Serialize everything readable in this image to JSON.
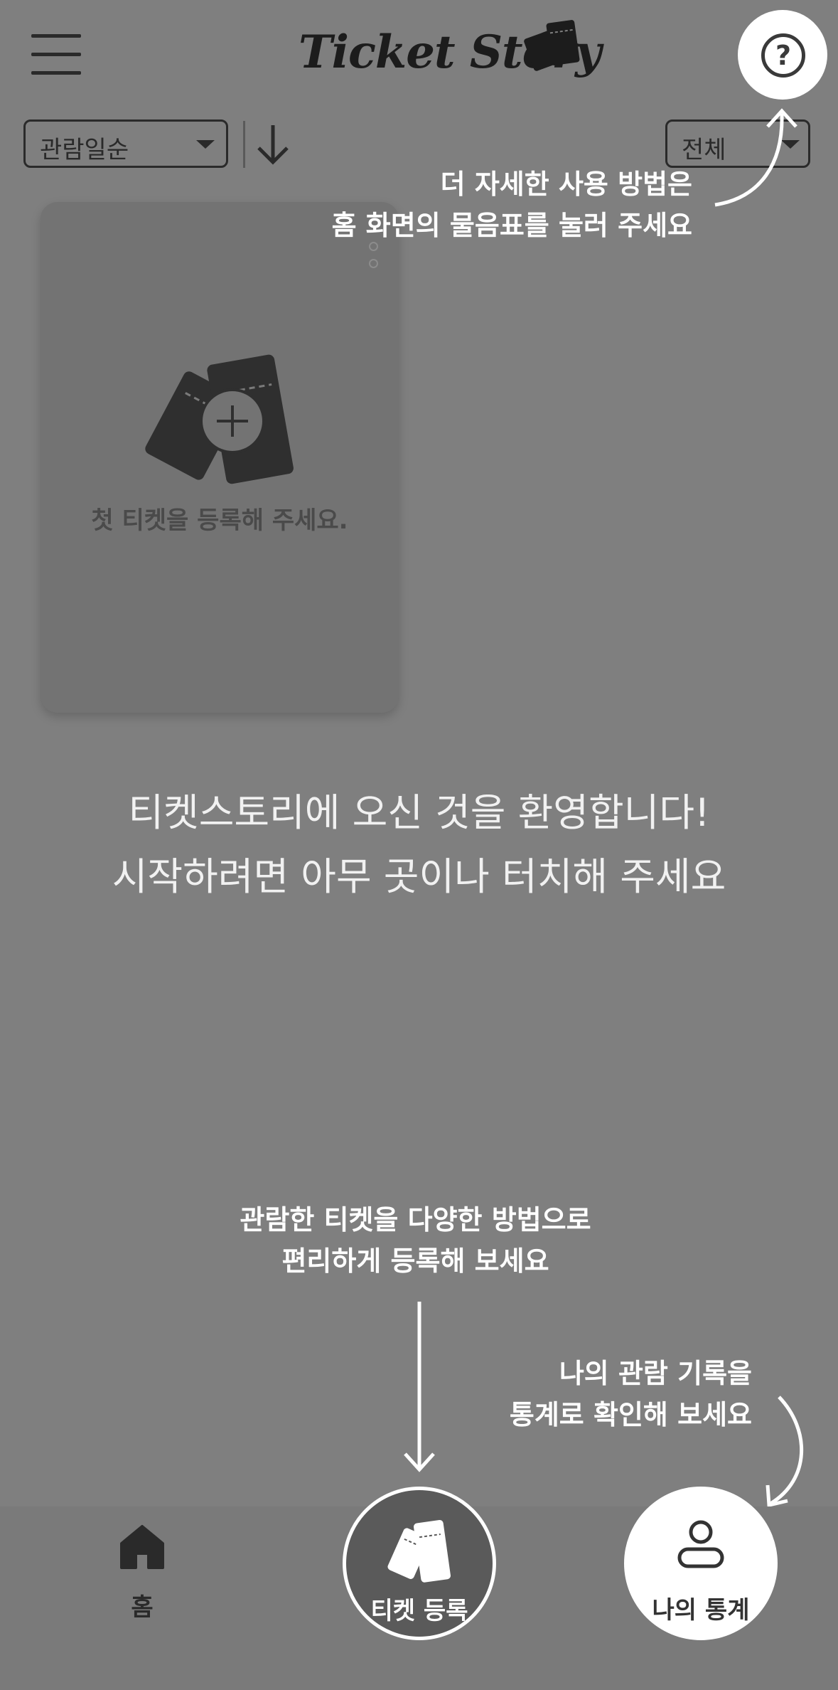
{
  "header": {
    "app_title": "Ticket Story",
    "menu_icon": "hamburger-menu-icon",
    "help_icon": "question-mark-icon"
  },
  "filters": {
    "sort_value": "관람일순",
    "sort_direction_icon": "arrow-down-icon",
    "category_value": "전체"
  },
  "card": {
    "empty_message": "첫 티켓을 등록해 주세요.",
    "add_icon": "ticket-plus-icon"
  },
  "welcome": {
    "line1": "티켓스토리에 오신 것을 환영합니다!",
    "line2": "시작하려면 아무 곳이나 터치해 주세요"
  },
  "tips": {
    "help_line1": "더 자세한 사용 방법은",
    "help_line2": "홈 화면의 물음표를 눌러 주세요",
    "register_line1": "관람한 티켓을 다양한 방법으로",
    "register_line2": "편리하게 등록해 보세요",
    "stats_line1": "나의 관람 기록을",
    "stats_line2": "통계로 확인해 보세요"
  },
  "nav": {
    "home_label": "홈",
    "home_icon": "home-icon",
    "register_label": "티켓 등록",
    "register_icon": "ticket-icon",
    "stats_label": "나의 통계",
    "stats_icon": "user-icon"
  },
  "colors": {
    "overlay_background": "#7f7f7f",
    "tip_text": "#ffffff"
  }
}
